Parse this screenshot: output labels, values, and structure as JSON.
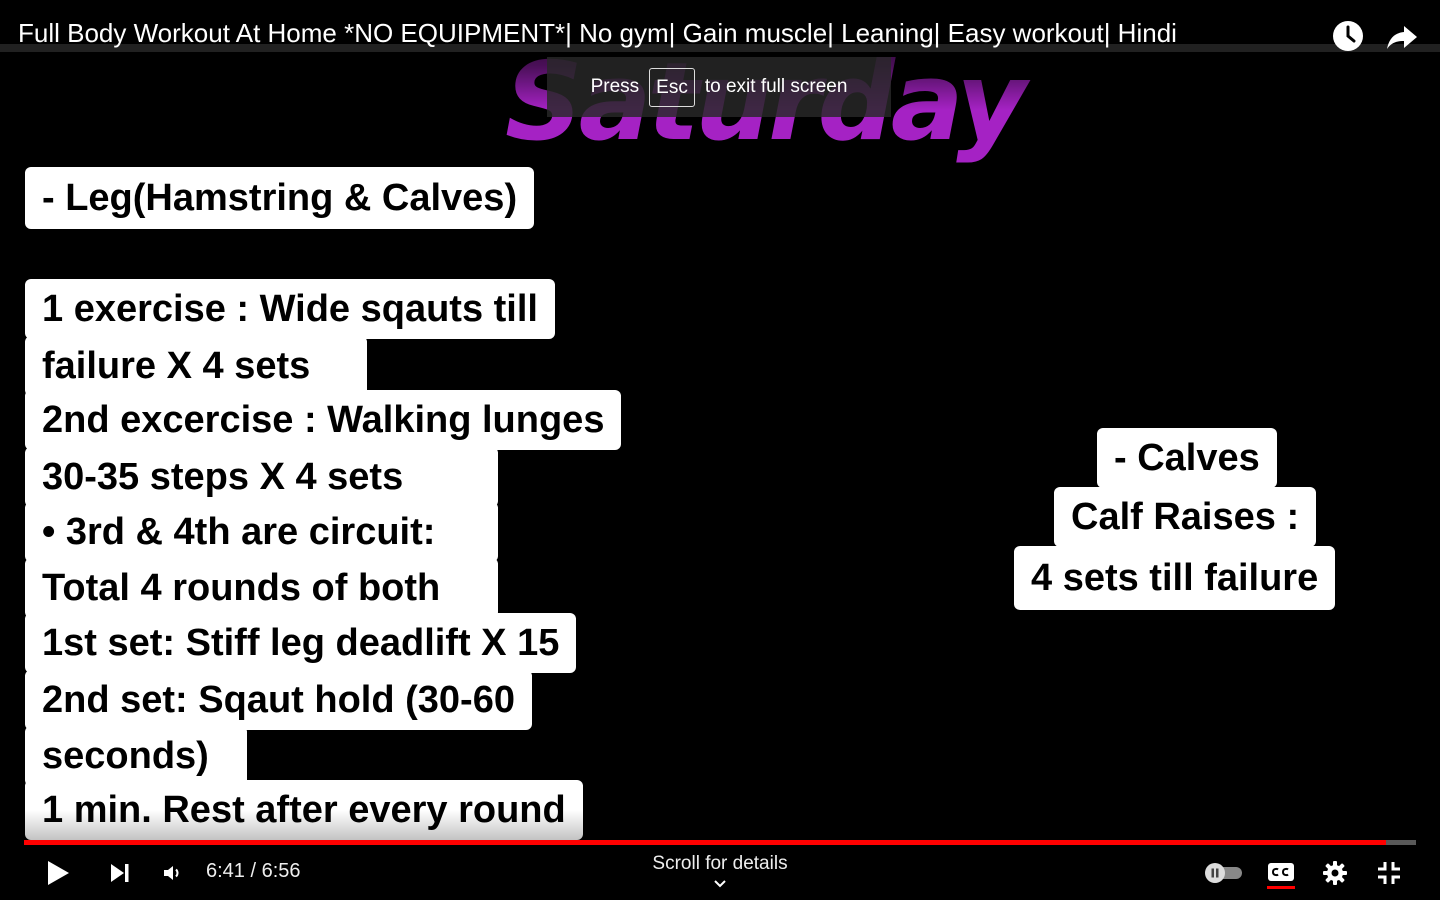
{
  "video": {
    "title": "Full Body Workout At Home *NO EQUIPMENT*| No gym| Gain muscle| Leaning| Easy workout| Hindi"
  },
  "esc_banner": {
    "prefix": "Press",
    "key": "Esc",
    "suffix": "to exit full screen"
  },
  "content": {
    "day": "Saturday",
    "section_heading": "- Leg(Hamstring & Calves)",
    "left_lines": [
      "1  exercise :  Wide sqauts till",
      "failure X  4 sets",
      "2nd excercise :   Walking lunges",
      "30-35 steps X 4 sets",
      "• 3rd & 4th are circuit:",
      "Total 4 rounds of both",
      "1st set: Stiff leg deadlift X 15",
      "2nd set: Sqaut hold (30-60",
      "seconds)",
      "1 min. Rest after every round"
    ],
    "right_lines": [
      "- Calves",
      "Calf Raises :",
      "4 sets till failure"
    ]
  },
  "controls": {
    "current_time": "6:41",
    "separator": " / ",
    "duration": "6:56",
    "time_display": "6:41 / 6:56",
    "progress_fraction": 0.9784,
    "scroll_hint": "Scroll for details"
  },
  "colors": {
    "progress": "#ff0000",
    "day_heading": "#a522c4"
  },
  "icons": {
    "watch_later": "clock-icon",
    "share": "share-icon",
    "play": "play-icon",
    "next": "next-icon",
    "volume": "volume-icon",
    "autoplay": "autoplay-toggle-icon",
    "captions": "cc-icon",
    "settings": "gear-icon",
    "exit_fullscreen": "exit-fullscreen-icon"
  }
}
